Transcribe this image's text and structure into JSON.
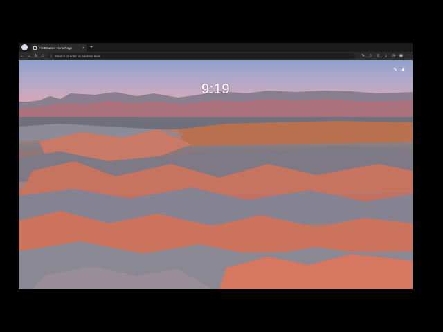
{
  "tab": {
    "title": "FireBrowser HomePage",
    "close": "×",
    "new": "+"
  },
  "profile": {
    "initial": ""
  },
  "toolbar": {
    "back": "←",
    "forward": "→",
    "reload": "↻",
    "home": "⌂",
    "address_placeholder": "Search or enter an address here",
    "info": "ⓘ",
    "right_icons": [
      "✎",
      "☆",
      "⟳",
      "⤓",
      "◷",
      "▦",
      "⋯"
    ]
  },
  "newtab": {
    "clock": "9:19",
    "edit_icon": "✎",
    "cursor": "▲"
  },
  "colors": {
    "sky_top": "#8c9ec9",
    "sky_pink": "#cba6ba",
    "rock_orange": "#d27a63",
    "rock_gray": "#7e7a84"
  }
}
